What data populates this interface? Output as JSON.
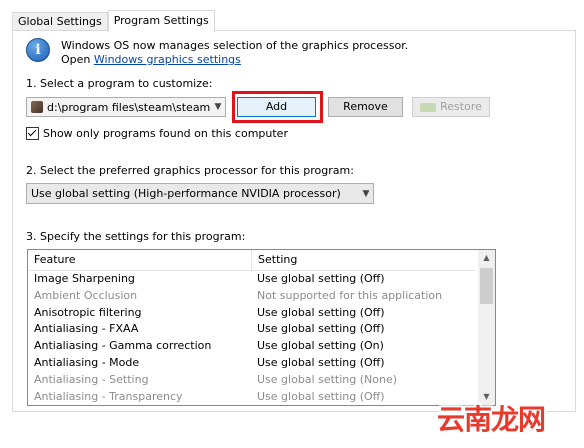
{
  "tabs": [
    {
      "label": "Global Settings"
    },
    {
      "label": "Program Settings"
    }
  ],
  "info": {
    "line1": "Windows OS now manages selection of the graphics processor.",
    "open_label": "Open",
    "link": "Windows graphics settings"
  },
  "section1": {
    "label": "1. Select a program to customize:",
    "program_value": "d:\\program files\\steam\\steama...",
    "add_button": "Add",
    "remove_button": "Remove",
    "restore_button": "Restore",
    "checkbox_label": "Show only programs found on this computer",
    "checkbox_checked": true
  },
  "section2": {
    "label": "2. Select the preferred graphics processor for this program:",
    "gpu_value": "Use global setting (High-performance NVIDIA processor)"
  },
  "section3": {
    "label": "3. Specify the settings for this program:",
    "columns": [
      "Feature",
      "Setting"
    ],
    "rows": [
      {
        "feature": "Image Sharpening",
        "setting": "Use global setting (Off)",
        "dim": false
      },
      {
        "feature": "Ambient Occlusion",
        "setting": "Not supported for this application",
        "dim": true
      },
      {
        "feature": "Anisotropic filtering",
        "setting": "Use global setting (Off)",
        "dim": false
      },
      {
        "feature": "Antialiasing - FXAA",
        "setting": "Use global setting (Off)",
        "dim": false
      },
      {
        "feature": "Antialiasing - Gamma correction",
        "setting": "Use global setting (On)",
        "dim": false
      },
      {
        "feature": "Antialiasing - Mode",
        "setting": "Use global setting (Off)",
        "dim": false
      },
      {
        "feature": "Antialiasing - Setting",
        "setting": "Use global setting (None)",
        "dim": true
      },
      {
        "feature": "Antialiasing - Transparency",
        "setting": "Use global setting (Off)",
        "dim": true
      }
    ]
  },
  "watermark": "云南龙网",
  "colors": {
    "highlight": "#e0131a",
    "link": "#0645ad",
    "watermark": "#e8392c"
  }
}
